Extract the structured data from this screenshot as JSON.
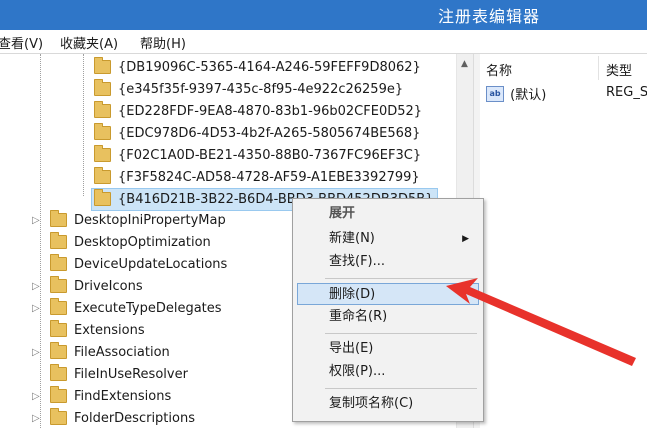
{
  "window": {
    "title": "注册表编辑器"
  },
  "menubar": {
    "view": "查看(V)",
    "favorites": "收藏夹(A)",
    "help": "帮助(H)"
  },
  "tree": {
    "guid_items": [
      "{DB19096C-5365-4164-A246-59FEFF9D8062}",
      "{e345f35f-9397-435c-8f95-4e922c26259e}",
      "{ED228FDF-9EA8-4870-83b1-96b02CFE0D52}",
      "{EDC978D6-4D53-4b2f-A265-5805674BE568}",
      "{F02C1A0D-BE21-4350-88B0-7367FC96EF3C}",
      "{F3F5824C-AD58-4728-AF59-A1EBE3392799}",
      "{B416D21B-3B22-B6D4-BBD3-BBD452DB3D5B}"
    ],
    "items": [
      "DesktopIniPropertyMap",
      "DesktopOptimization",
      "DeviceUpdateLocations",
      "DriveIcons",
      "ExecuteTypeDelegates",
      "Extensions",
      "FileAssociation",
      "FileInUseResolver",
      "FindExtensions",
      "FolderDescriptions"
    ]
  },
  "values_pane": {
    "col_name": "名称",
    "col_type": "类型",
    "row_name": "(默认)",
    "row_type": "REG_S",
    "row_icon": "ab"
  },
  "context_menu": {
    "expand": "展开",
    "new": "新建(N)",
    "find": "查找(F)...",
    "delete": "删除(D)",
    "rename": "重命名(R)",
    "export": "导出(E)",
    "permissions": "权限(P)...",
    "copy_key_name": "复制项名称(C)"
  },
  "colors": {
    "titlebar": "#2f76c8",
    "highlight_arrow": "#e8322b"
  }
}
